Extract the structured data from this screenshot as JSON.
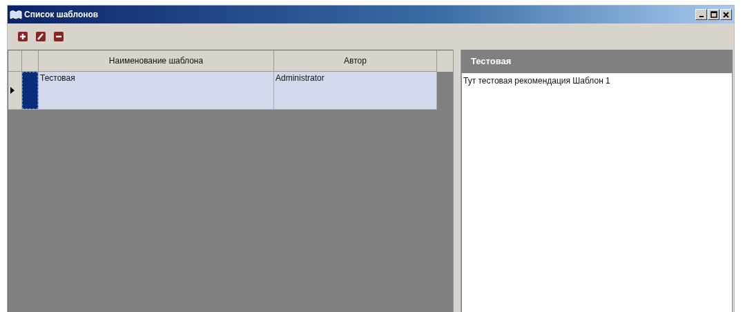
{
  "window": {
    "title": "Список шаблонов"
  },
  "table": {
    "columns": [
      "Наименование шаблона",
      "Автор"
    ],
    "rows": [
      {
        "name": "Тестовая",
        "author": "Administrator",
        "selected": true
      }
    ]
  },
  "detail": {
    "title": "Тестовая",
    "text": "Тут тестовая рекомендация Шаблон 1"
  }
}
